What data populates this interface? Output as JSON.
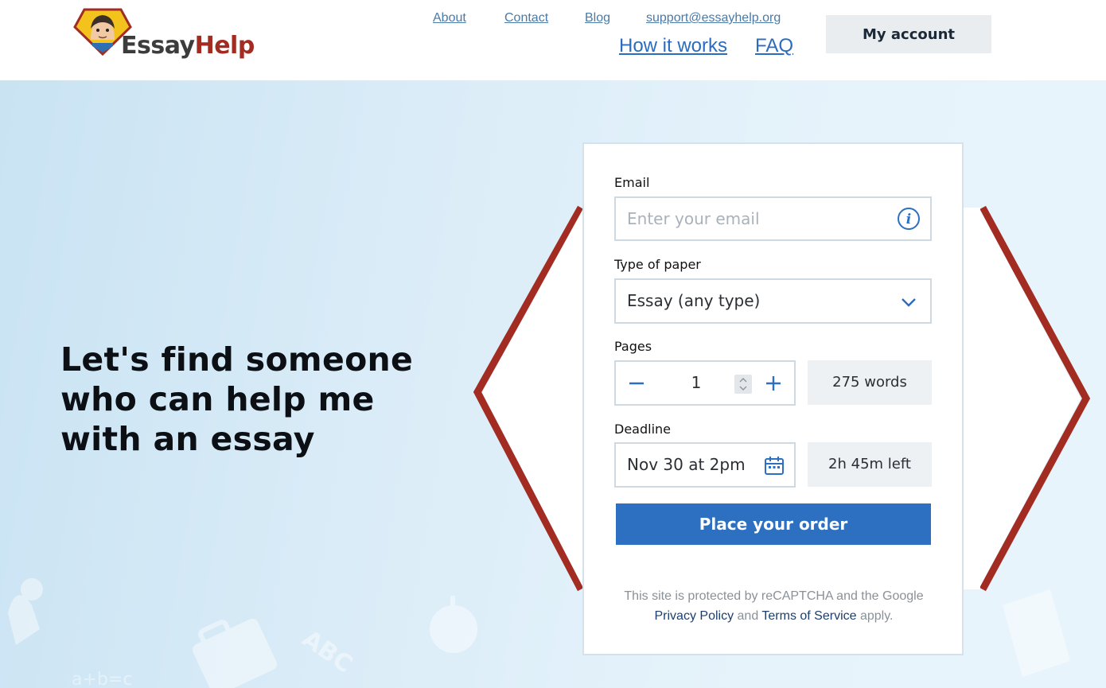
{
  "brand": {
    "logo_part1": "Essay",
    "logo_part2": "Help",
    "accent_color": "#a32c22"
  },
  "nav": {
    "about": "About",
    "contact": "Contact",
    "blog": "Blog",
    "support_email": "support@essayhelp.org",
    "how_it_works": "How it works",
    "faq": "FAQ",
    "my_account": "My account"
  },
  "hero": {
    "headline": "Let's find someone who can help me with an essay"
  },
  "form": {
    "email_label": "Email",
    "email_placeholder": "Enter your email",
    "email_info_icon": "info-icon",
    "paper_label": "Type of paper",
    "paper_value": "Essay (any type)",
    "pages_label": "Pages",
    "pages_value": "1",
    "words": "275 words",
    "deadline_label": "Deadline",
    "deadline_value": "Nov 30 at 2pm",
    "time_left": "2h 45m left",
    "submit_label": "Place your order",
    "button_color": "#2d6fc1"
  },
  "legal": {
    "line1": "This site is protected by reCAPTCHA and the Google",
    "privacy": "Privacy Policy",
    "and": "and",
    "terms": "Terms of Service",
    "apply": "apply."
  }
}
